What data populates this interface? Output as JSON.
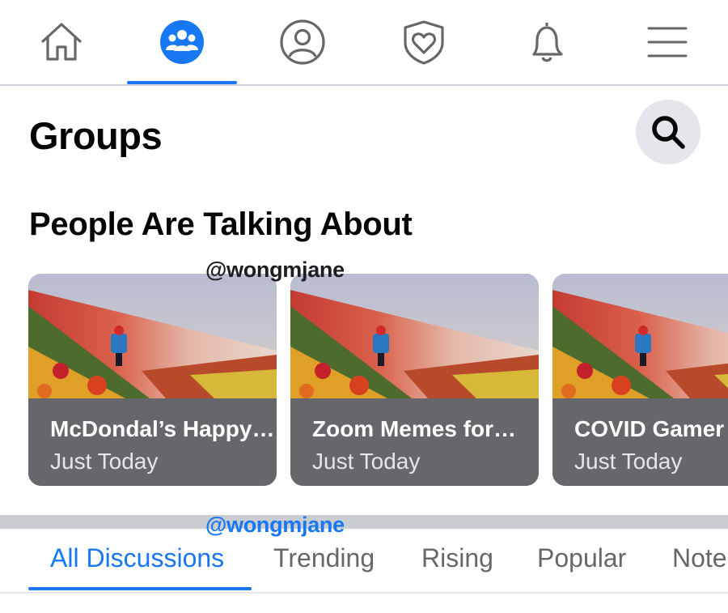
{
  "colors": {
    "accent": "#1877f2",
    "icon_gray": "#65676b",
    "card_body": "#65676b",
    "search_bg": "#e4e6eb"
  },
  "top_nav": {
    "items": [
      {
        "icon": "home-icon",
        "active": false
      },
      {
        "icon": "groups-icon",
        "active": true
      },
      {
        "icon": "profile-icon",
        "active": false
      },
      {
        "icon": "dating-heart-icon",
        "active": false
      },
      {
        "icon": "bell-icon",
        "active": false
      },
      {
        "icon": "menu-icon",
        "active": false
      }
    ]
  },
  "header": {
    "title": "Groups",
    "search_icon": "search-icon"
  },
  "talking_about": {
    "title": "People Are Talking About",
    "cards": [
      {
        "title": "McDondal’s Happy…",
        "subtitle": "Just Today"
      },
      {
        "title": "Zoom Memes for…",
        "subtitle": "Just Today"
      },
      {
        "title": "COVID Gamer S",
        "subtitle": "Just Today"
      }
    ]
  },
  "watermarks": [
    "@wongmjane",
    "@wongmjane"
  ],
  "tabs": {
    "items": [
      "All Discussions",
      "Trending",
      "Rising",
      "Popular",
      "Note"
    ],
    "active": "All Discussions"
  }
}
